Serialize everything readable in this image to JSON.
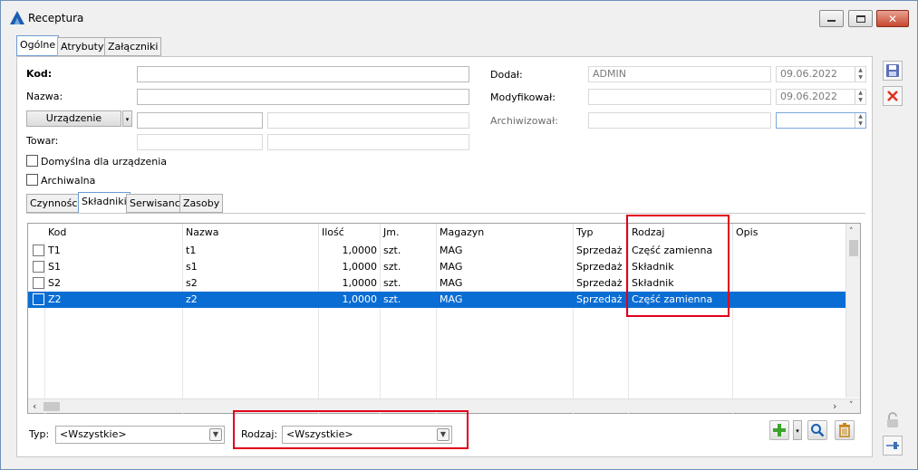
{
  "window": {
    "title": "Receptura"
  },
  "tabs": [
    {
      "label": "Ogólne"
    },
    {
      "label": "Atrybuty"
    },
    {
      "label": "Załączniki"
    }
  ],
  "form": {
    "kod_label": "Kod:",
    "nazwa_label": "Nazwa:",
    "urzadzenie_button": "Urządzenie",
    "towar_label": "Towar:",
    "domyslna_label": "Domyślna dla urządzenia",
    "archiwalna_label": "Archiwalna",
    "dodal_label": "Dodał:",
    "dodal_value": "ADMIN",
    "dodal_date": "09.06.2022",
    "modyfikowal_label": "Modyfikował:",
    "modyfikowal_date": "09.06.2022",
    "archiwizowal_label": "Archiwizował:"
  },
  "subtabs": [
    {
      "label": "Czynności"
    },
    {
      "label": "Składniki"
    },
    {
      "label": "Serwisanci"
    },
    {
      "label": "Zasoby"
    }
  ],
  "grid": {
    "columns": [
      "Kod",
      "Nazwa",
      "Ilość",
      "Jm.",
      "Magazyn",
      "Typ",
      "Rodzaj",
      "Opis"
    ],
    "rows": [
      {
        "kod": "T1",
        "nazwa": "t1",
        "ilosc": "1,0000",
        "jm": "szt.",
        "magazyn": "MAG",
        "typ": "Sprzedaż",
        "rodzaj": "Część zamienna",
        "opis": ""
      },
      {
        "kod": "S1",
        "nazwa": "s1",
        "ilosc": "1,0000",
        "jm": "szt.",
        "magazyn": "MAG",
        "typ": "Sprzedaż",
        "rodzaj": "Składnik",
        "opis": ""
      },
      {
        "kod": "S2",
        "nazwa": "s2",
        "ilosc": "1,0000",
        "jm": "szt.",
        "magazyn": "MAG",
        "typ": "Sprzedaż",
        "rodzaj": "Składnik",
        "opis": ""
      },
      {
        "kod": "Z2",
        "nazwa": "z2",
        "ilosc": "1,0000",
        "jm": "szt.",
        "magazyn": "MAG",
        "typ": "Sprzedaż",
        "rodzaj": "Część zamienna",
        "opis": ""
      }
    ]
  },
  "filters": {
    "typ_label": "Typ:",
    "typ_value": "<Wszystkie>",
    "rodzaj_label": "Rodzaj:",
    "rodzaj_value": "<Wszystkie>"
  },
  "colors": {
    "selection": "#0a6dd3",
    "highlight": "#e0001b",
    "accent": "#1c5fb0"
  }
}
